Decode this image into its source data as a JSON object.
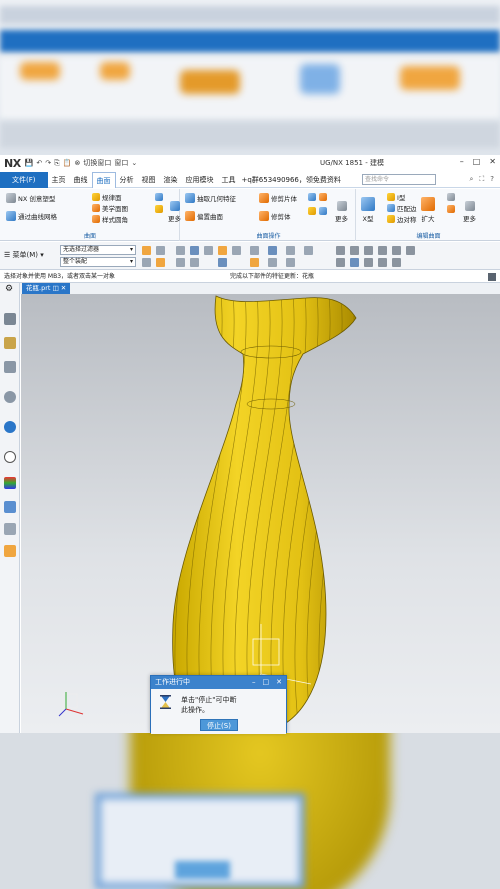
{
  "app": {
    "logo": "NX",
    "title": "UG/NX 1851 - 建模",
    "quick_access": [
      "切换窗口",
      "窗口"
    ]
  },
  "menu": {
    "file": "文件(F)",
    "items": [
      "主页",
      "曲线",
      "曲面",
      "分析",
      "视图",
      "渲染",
      "应用模块",
      "工具"
    ],
    "active": "曲面",
    "promo": "+q群653490966，领免费资料",
    "search_placeholder": "查找命令"
  },
  "ribbon": {
    "group1": {
      "items": [
        "NX 创意塑型",
        "通过曲线网格"
      ],
      "label": "曲面"
    },
    "group1b": {
      "items": [
        "规律面",
        "美学面图",
        "样式圆角"
      ]
    },
    "more1": "更多",
    "group2": {
      "items": [
        "抽取几何特征",
        "修剪片体",
        "偏置曲面",
        "修剪体"
      ],
      "label": "曲面操作"
    },
    "more2": "更多",
    "group3": {
      "items": [
        "X型",
        "I型",
        "匹配边",
        "边对称",
        "扩大"
      ],
      "label": "编辑曲面"
    },
    "more3": "更多"
  },
  "toolbar": {
    "menu_label": "菜单(M)",
    "filter": "无选择过滤器",
    "assembly": "整个装配"
  },
  "status": {
    "left": "选择对象并使用 MB3，或者双击某一对象",
    "right": "完成以下部件的特征更新：花瓶"
  },
  "document_tab": "花瓶.prt",
  "dialog": {
    "title": "工作进行中",
    "message_line1": "单击\"停止\"可中断",
    "message_line2": "此操作。",
    "stop_button": "停止(S)"
  },
  "colors": {
    "accent": "#1e6fc1",
    "vase": "#e6c51a"
  }
}
